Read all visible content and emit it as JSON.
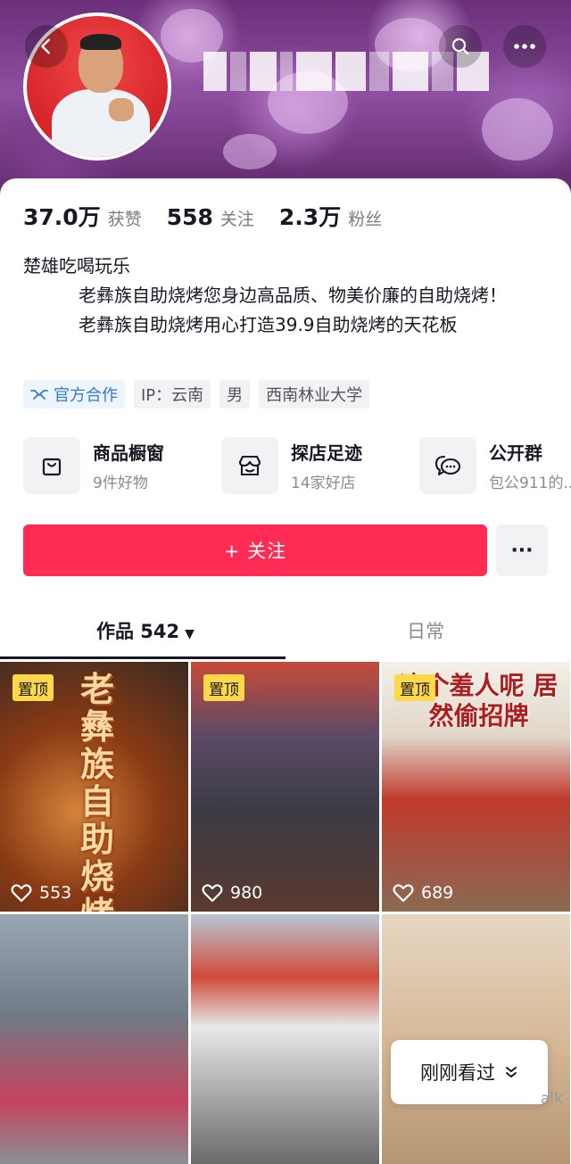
{
  "profile": {
    "stats": [
      {
        "value": "37.0万",
        "label": "获赞"
      },
      {
        "value": "558",
        "label": "关注"
      },
      {
        "value": "2.3万",
        "label": "粉丝"
      }
    ],
    "bio": {
      "line1": "楚雄吃喝玩乐",
      "line2": "老彝族自助烧烤您身边高品质、物美价廉的自助烧烤！",
      "line3": "老彝族自助烧烤用心打造39.9自助烧烤的天花板"
    },
    "tags": {
      "official": "官方合作",
      "ip": "IP：云南",
      "gender": "男",
      "school": "西南林业大学"
    }
  },
  "services": [
    {
      "title": "商品橱窗",
      "subtitle": "9件好物",
      "icon": "bag-icon"
    },
    {
      "title": "探店足迹",
      "subtitle": "14家好店",
      "icon": "shop-icon"
    },
    {
      "title": "公开群",
      "subtitle": "包公911的..",
      "icon": "chat-icon"
    }
  ],
  "actions": {
    "follow_label": "+ 关注",
    "more_label": "···"
  },
  "tabs": {
    "works_label": "作品 542",
    "daily_label": "日常"
  },
  "videos": [
    {
      "pinned": "置顶",
      "likes": "553",
      "overlay": "老彝族自助烧烤"
    },
    {
      "pinned": "置顶",
      "likes": "980",
      "overlay": ""
    },
    {
      "pinned": "置顶",
      "likes": "689",
      "overlay": "这个羞人呢 居然偷招牌"
    },
    {
      "pinned": "",
      "likes": "",
      "overlay": ""
    },
    {
      "pinned": "",
      "likes": "",
      "overlay": ""
    },
    {
      "pinned": "",
      "likes": "",
      "overlay": ""
    }
  ],
  "floating": {
    "recent_label": "刚刚看过"
  },
  "watermark": "alk",
  "colors": {
    "accent": "#fe2c55",
    "pin": "#fdd84a",
    "official_blue": "#2f7bd3"
  }
}
